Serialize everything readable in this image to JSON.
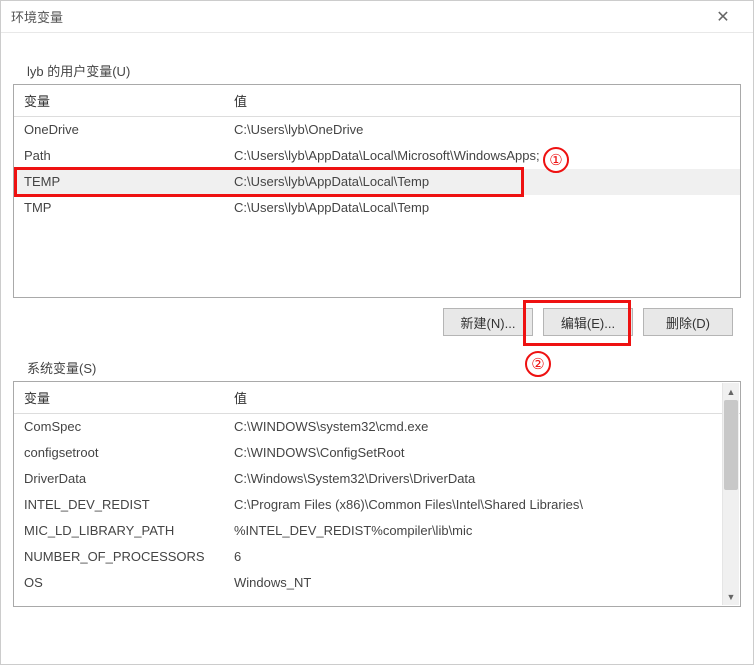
{
  "window": {
    "title": "环境变量"
  },
  "userSection": {
    "label": "lyb 的用户变量(U)",
    "header": {
      "var": "变量",
      "val": "值"
    },
    "rows": [
      {
        "var": "OneDrive",
        "val": "C:\\Users\\lyb\\OneDrive"
      },
      {
        "var": "Path",
        "val": "C:\\Users\\lyb\\AppData\\Local\\Microsoft\\WindowsApps;"
      },
      {
        "var": "TEMP",
        "val": "C:\\Users\\lyb\\AppData\\Local\\Temp"
      },
      {
        "var": "TMP",
        "val": "C:\\Users\\lyb\\AppData\\Local\\Temp"
      }
    ]
  },
  "buttons": {
    "new": "新建(N)...",
    "edit": "编辑(E)...",
    "delete": "删除(D)"
  },
  "sysSection": {
    "label": "系统变量(S)",
    "header": {
      "var": "变量",
      "val": "值"
    },
    "rows": [
      {
        "var": "ComSpec",
        "val": "C:\\WINDOWS\\system32\\cmd.exe"
      },
      {
        "var": "configsetroot",
        "val": "C:\\WINDOWS\\ConfigSetRoot"
      },
      {
        "var": "DriverData",
        "val": "C:\\Windows\\System32\\Drivers\\DriverData"
      },
      {
        "var": "INTEL_DEV_REDIST",
        "val": "C:\\Program Files (x86)\\Common Files\\Intel\\Shared Libraries\\"
      },
      {
        "var": "MIC_LD_LIBRARY_PATH",
        "val": "%INTEL_DEV_REDIST%compiler\\lib\\mic"
      },
      {
        "var": "NUMBER_OF_PROCESSORS",
        "val": "6"
      },
      {
        "var": "OS",
        "val": "Windows_NT"
      }
    ]
  },
  "annotations": {
    "one": "①",
    "two": "②"
  }
}
